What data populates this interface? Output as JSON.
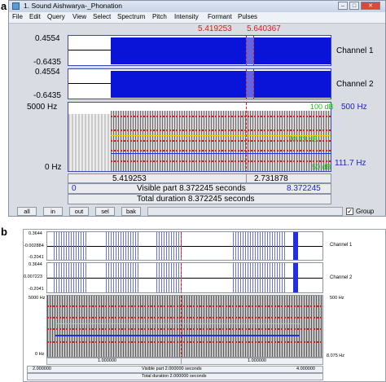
{
  "panel_a": {
    "letter": "a",
    "window_title": "1. Sound Aishwarya-_Phonation",
    "menu": [
      "File",
      "Edit",
      "Query",
      "View",
      "Select",
      "Spectrum",
      "Pitch",
      "Intensity",
      "Formant",
      "Pulses"
    ],
    "cursor_left": "5.419253",
    "cursor_right": "5.640367",
    "channel1": {
      "label": "Channel 1",
      "max": "0.4554",
      "min": "-0.6435"
    },
    "channel2": {
      "label": "Channel 2",
      "max": "0.4554",
      "min": "-0.6435"
    },
    "spectrogram": {
      "freq_top": "5000 Hz",
      "freq_bottom": "0 Hz",
      "intensity_top": "100 dB",
      "pitch_top": "500 Hz",
      "intensity_mid": "70.13 dB",
      "intensity_bottom": "50 dB",
      "pitch_bottom": "111.7 Hz"
    },
    "time_row": {
      "left": "5.419253",
      "right": "2.731878"
    },
    "visible_row": {
      "start": "0",
      "text": "Visible part 8.372245 seconds",
      "end": "8.372245"
    },
    "total_row": "Total duration 8.372245 seconds",
    "buttons": [
      "all",
      "in",
      "out",
      "sel",
      "bak"
    ],
    "group_label": "Group"
  },
  "panel_b": {
    "letter": "b",
    "channel1": {
      "label": "Channel 1",
      "max": "0.3644",
      "mid": "-0.002884",
      "min": "-0.2041"
    },
    "channel2": {
      "label": "Channel 2",
      "max": "0.3644",
      "mid": "0.007223",
      "min": "-0.2041"
    },
    "freq_top": "5000 Hz",
    "freq_bottom": "0 Hz",
    "pitch_top": "500 Hz",
    "pitch_bottom": "8.075 Hz",
    "tick_mid1": "1.000000",
    "tick_mid2": "1.000000",
    "visible_row": {
      "start": "2.000000",
      "text": "Visible part 2.000000 seconds",
      "end": "4.000000"
    },
    "total_row": "Total duration 2.000000 seconds"
  },
  "colors": {
    "waveform_fill": "#0a14d8",
    "cursor": "#e01818",
    "pitch": "#2030e0",
    "formant": "#e81818",
    "intensity": "#e8d000"
  }
}
